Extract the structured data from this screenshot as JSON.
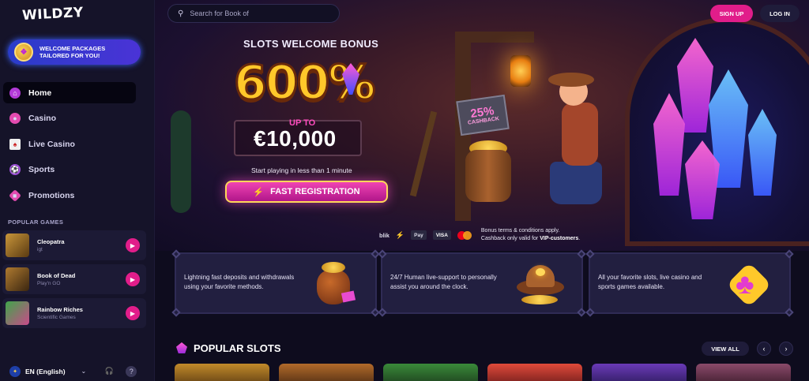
{
  "brand": {
    "logo_text": "WILDZY"
  },
  "sidebar": {
    "welcome_banner": "WELCOME PACKAGES TAILORED FOR YOU!",
    "nav": [
      {
        "label": "Home",
        "icon": "home-icon",
        "active": true
      },
      {
        "label": "Casino",
        "icon": "casino-chip-icon",
        "active": false
      },
      {
        "label": "Live Casino",
        "icon": "cards-icon",
        "active": false
      },
      {
        "label": "Sports",
        "icon": "soccer-ball-icon",
        "active": false
      },
      {
        "label": "Promotions",
        "icon": "gift-icon",
        "active": false
      }
    ],
    "popular_games_title": "POPULAR GAMES",
    "popular_games": [
      {
        "name": "Cleopatra",
        "provider": "igt"
      },
      {
        "name": "Book of Dead",
        "provider": "Play'n GO"
      },
      {
        "name": "Rainbow Riches",
        "provider": "Scientific Games"
      }
    ],
    "language": "EN (English)"
  },
  "header": {
    "search_placeholder": "Search for Book of",
    "signup_label": "SIGN UP",
    "login_label": "LOG IN"
  },
  "hero": {
    "title": "SLOTS WELCOME BONUS",
    "big_percent": "600%",
    "up_to": "UP TO",
    "amount": "€10,000",
    "subtitle": "Start playing in less than 1 minute",
    "cta": "FAST REGISTRATION",
    "cashback_percent": "25%",
    "cashback_label": "CASHBACK",
    "payment_methods": [
      "blik",
      "Pay",
      "VISA"
    ],
    "terms_line1": "Bonus terms & conditions apply.",
    "terms_line2_prefix": "Cashback only valid for ",
    "terms_line2_bold": "VIP-customers",
    "terms_line2_suffix": "."
  },
  "features": [
    {
      "text": "Lightning fast deposits and withdrawals using your favorite methods."
    },
    {
      "text": "24/7 Human live-support to personally assist you around the clock."
    },
    {
      "text": "All your favorite slots, live casino and sports games available."
    }
  ],
  "popular_slots": {
    "title": "POPULAR SLOTS",
    "view_all": "VIEW ALL"
  },
  "colors": {
    "accent_pink": "#e11d8a",
    "gold": "#ffc82a",
    "bg": "#0e0c1e",
    "sidebar_bg": "#151329"
  }
}
